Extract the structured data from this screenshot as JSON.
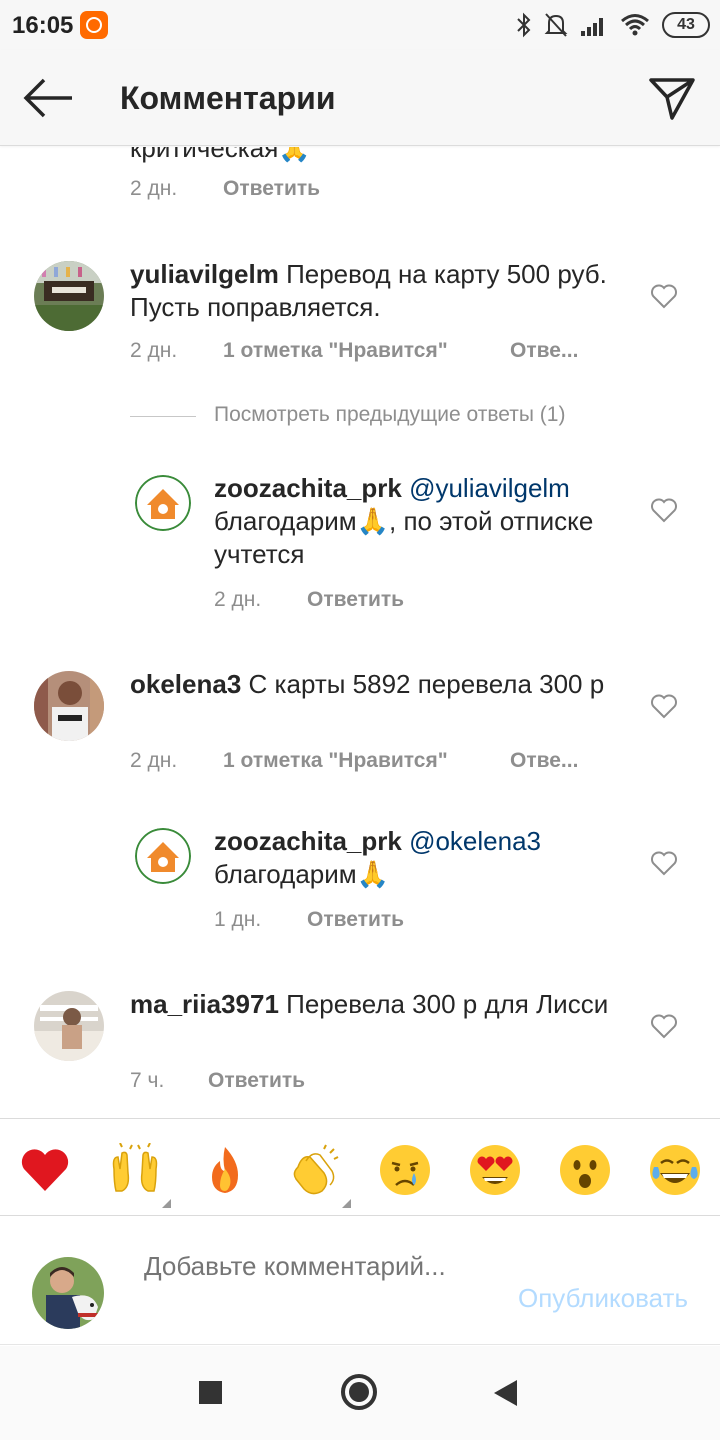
{
  "status_bar": {
    "time": "16:05",
    "battery": "43",
    "icons": [
      "mi-icon",
      "bluetooth-icon",
      "bell-off-icon",
      "signal-icon",
      "wifi-icon",
      "battery-icon"
    ]
  },
  "header": {
    "title": "Комментарии",
    "back_icon": "arrow-left-icon",
    "send_icon": "paper-plane-icon"
  },
  "comments": {
    "partial": {
      "text": "критическая🙏",
      "time": "2 дн.",
      "reply": "Ответить"
    },
    "c1": {
      "user": "yuliavilgelm",
      "text": "Перевод на карту 500 руб. Пусть поправляется.",
      "time": "2 дн.",
      "likes": "1 отметка \"Нравится\"",
      "reply": "Отве..."
    },
    "view_previous": "Посмотреть предыдущие ответы (1)",
    "r1": {
      "user": "zoozachita_prk",
      "mention": "@yuliavilgelm",
      "text": "благодарим🙏, по этой отписке учтется",
      "time": "2 дн.",
      "reply": "Ответить"
    },
    "c2": {
      "user": "okelena3",
      "text": "С карты 5892 перевела 300 р",
      "time": "2 дн.",
      "likes": "1 отметка \"Нравится\"",
      "reply": "Отве..."
    },
    "r2": {
      "user": "zoozachita_prk",
      "mention": "@okelena3",
      "text": "благодарим🙏",
      "time": "1 дн.",
      "reply": "Ответить"
    },
    "c3": {
      "user": "ma_riia3971",
      "text": "Перевела 300 р для Лисси",
      "time": "7 ч.",
      "reply": "Ответить"
    }
  },
  "emoji_bar": [
    "red-heart",
    "raising-hands",
    "fire",
    "clapping-hands",
    "crying-face",
    "heart-eyes-face",
    "astonished-face",
    "tears-of-joy-face"
  ],
  "composer": {
    "placeholder": "Добавьте комментарий...",
    "publish": "Опубликовать"
  },
  "colors": {
    "link": "#00376b",
    "publish_disabled": "#b3dbff",
    "meta": "#8e8e8e"
  }
}
